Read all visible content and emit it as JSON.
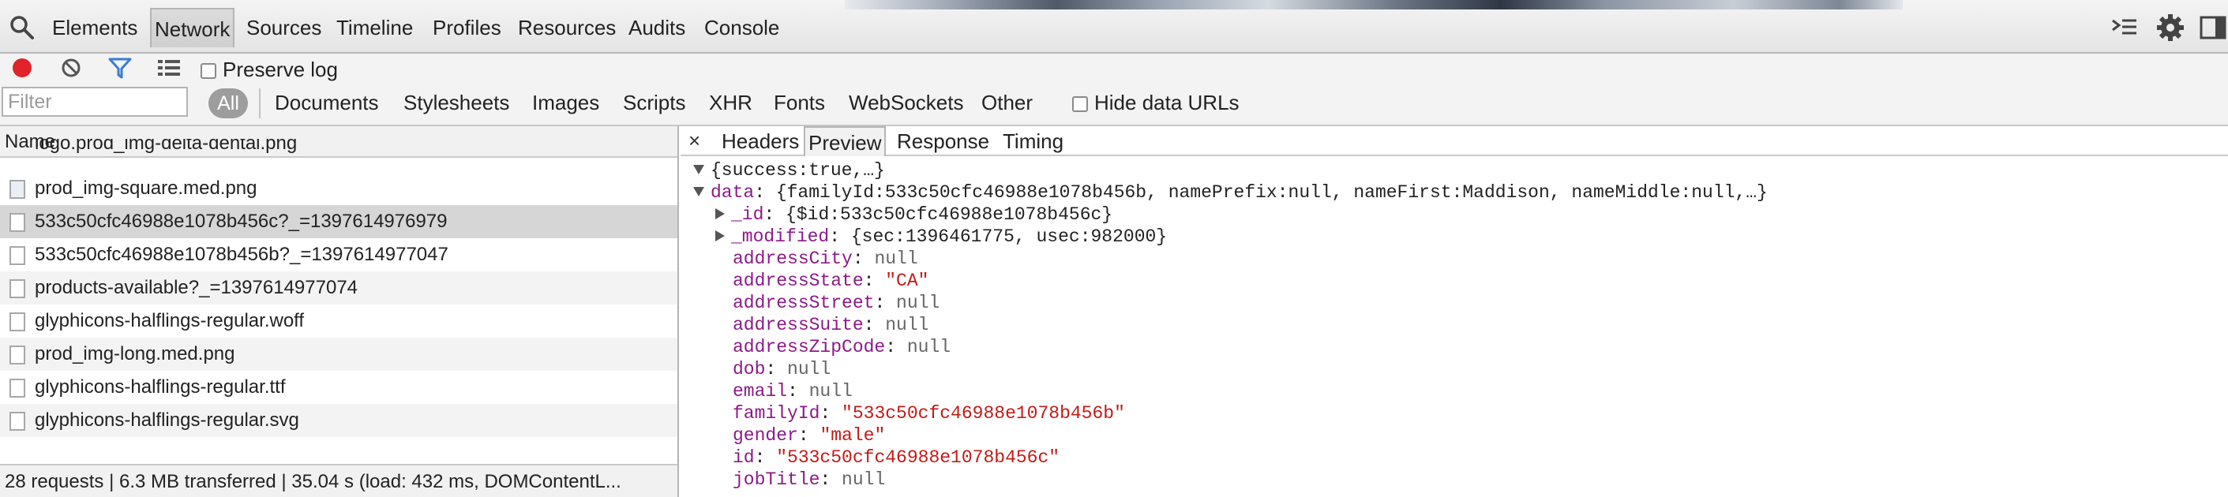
{
  "toolbar": {
    "tabs": [
      "Elements",
      "Network",
      "Sources",
      "Timeline",
      "Profiles",
      "Resources",
      "Audits",
      "Console"
    ],
    "active_tab": "Network"
  },
  "network_toolbar": {
    "preserve_log_label": "Preserve log",
    "preserve_log_checked": false
  },
  "filter_bar": {
    "placeholder": "Filter",
    "value": "",
    "all_label": "All",
    "types": [
      "Documents",
      "Stylesheets",
      "Images",
      "Scripts",
      "XHR",
      "Fonts",
      "WebSockets",
      "Other"
    ],
    "hide_data_urls_label": "Hide data URLs",
    "hide_data_urls_checked": false
  },
  "requests": {
    "column_header": "Name",
    "items": [
      {
        "name": "logo.prod_img-delta-dental.png",
        "icon": "image-file-icon"
      },
      {
        "name": "prod_img-square.med.png",
        "icon": "broken-image-icon"
      },
      {
        "name": "533c50cfc46988e1078b456c?_=1397614976979",
        "icon": "document-file-icon",
        "selected": true
      },
      {
        "name": "533c50cfc46988e1078b456b?_=1397614977047",
        "icon": "document-file-icon"
      },
      {
        "name": "products-available?_=1397614977074",
        "icon": "document-file-icon"
      },
      {
        "name": "glyphicons-halflings-regular.woff",
        "icon": "document-file-icon"
      },
      {
        "name": "prod_img-long.med.png",
        "icon": "image-file-icon"
      },
      {
        "name": "glyphicons-halflings-regular.ttf",
        "icon": "document-file-icon"
      },
      {
        "name": "glyphicons-halflings-regular.svg",
        "icon": "document-file-icon"
      }
    ],
    "status": "28 requests | 6.3 MB transferred | 35.04 s (load: 432 ms, DOMContentL..."
  },
  "detail": {
    "tabs": [
      "Headers",
      "Preview",
      "Response",
      "Timing"
    ],
    "active_tab": "Preview",
    "close_symbol": "×",
    "root_summary": "{success:true,…}",
    "data_key": "data",
    "data_summary": "{familyId:533c50cfc46988e1078b456b, namePrefix:null, nameFirst:Maddison, nameMiddle:null,…}",
    "id_key": "_id",
    "id_summary": "{$id:533c50cfc46988e1078b456c}",
    "modified_key": "_modified",
    "modified_summary": "{sec:1396461775, usec:982000}",
    "fields": [
      {
        "key": "addressCity",
        "value": "null",
        "type": "null"
      },
      {
        "key": "addressState",
        "value": "\"CA\"",
        "type": "string"
      },
      {
        "key": "addressStreet",
        "value": "null",
        "type": "null"
      },
      {
        "key": "addressSuite",
        "value": "null",
        "type": "null"
      },
      {
        "key": "addressZipCode",
        "value": "null",
        "type": "null"
      },
      {
        "key": "dob",
        "value": "null",
        "type": "null"
      },
      {
        "key": "email",
        "value": "null",
        "type": "null"
      },
      {
        "key": "familyId",
        "value": "\"533c50cfc46988e1078b456b\"",
        "type": "string"
      },
      {
        "key": "gender",
        "value": "\"male\"",
        "type": "string"
      },
      {
        "key": "id",
        "value": "\"533c50cfc46988e1078b456c\"",
        "type": "string"
      },
      {
        "key": "jobTitle",
        "value": "null",
        "type": "null"
      }
    ]
  },
  "colors": {
    "record_red": "#e0242a",
    "filter_blue": "#3a7bd5",
    "key_purple": "#8b1a89",
    "string_red": "#c41a16"
  }
}
